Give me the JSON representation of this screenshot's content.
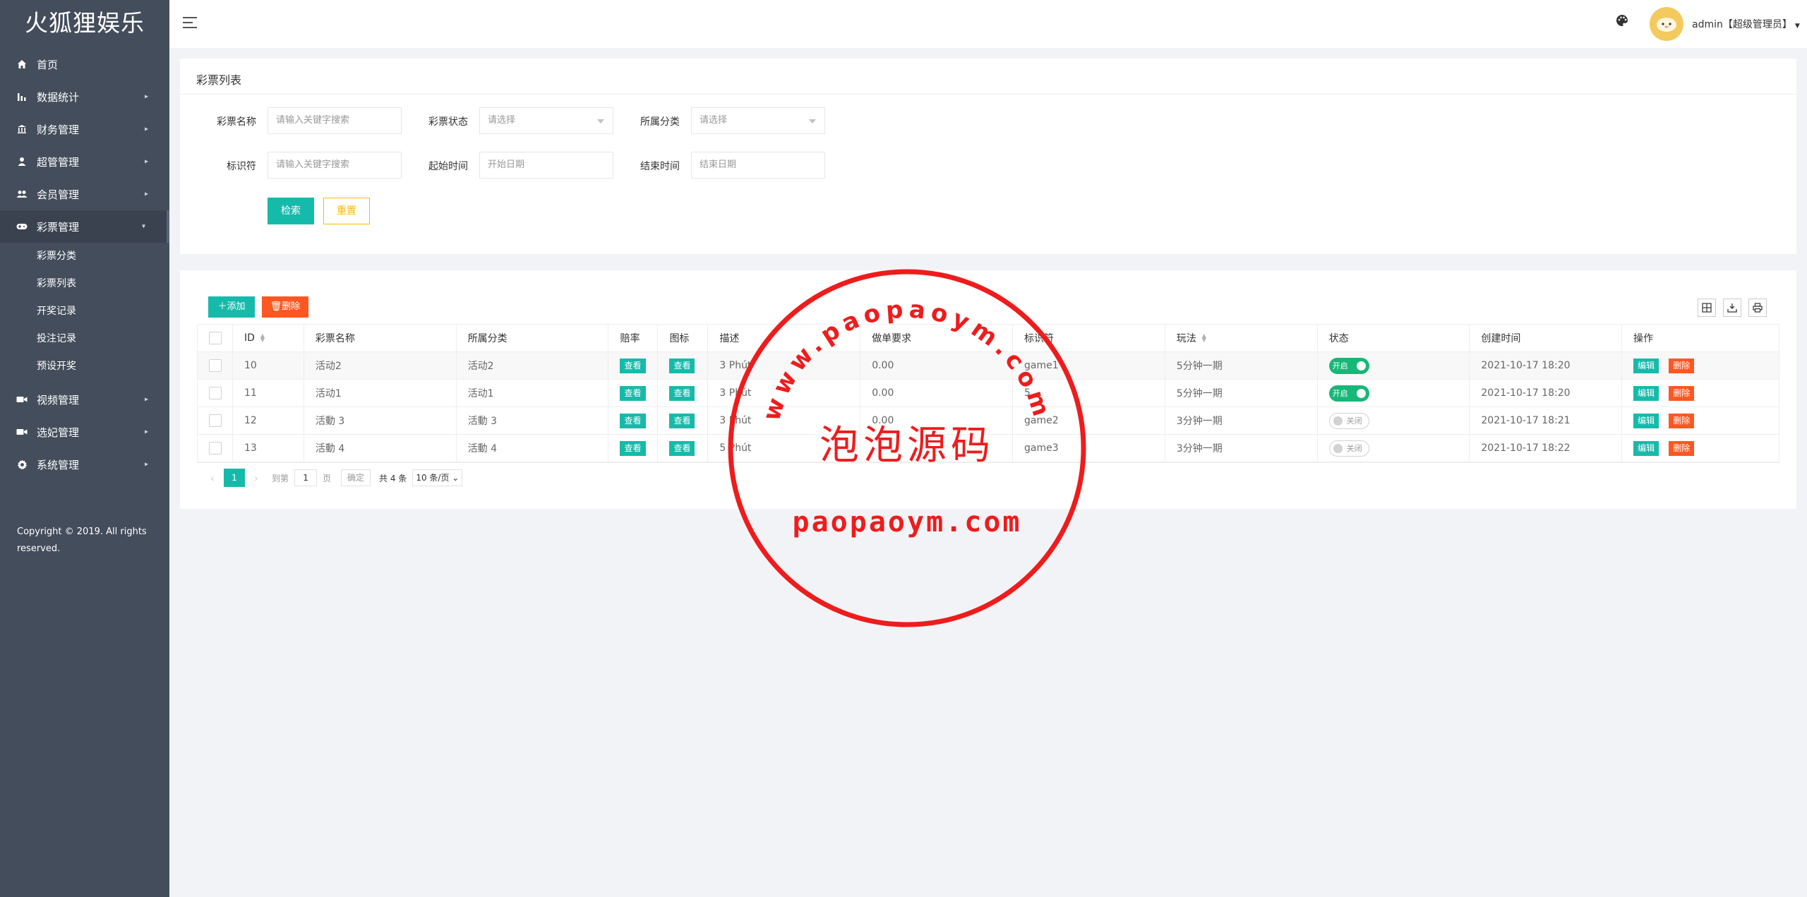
{
  "app": {
    "logo": "火狐狸娱乐"
  },
  "sidebar": {
    "items": [
      {
        "label": "首页",
        "icon": "home-icon"
      },
      {
        "label": "数据统计",
        "icon": "bar-chart-icon"
      },
      {
        "label": "财务管理",
        "icon": "bank-icon"
      },
      {
        "label": "超管管理",
        "icon": "user-icon"
      },
      {
        "label": "会员管理",
        "icon": "users-icon"
      },
      {
        "label": "彩票管理",
        "icon": "gamepad-icon"
      },
      {
        "label": "视频管理",
        "icon": "video-icon"
      },
      {
        "label": "选妃管理",
        "icon": "video-icon"
      },
      {
        "label": "系统管理",
        "icon": "gear-icon"
      }
    ],
    "sub_items": [
      {
        "label": "彩票分类"
      },
      {
        "label": "彩票列表"
      },
      {
        "label": "开奖记录"
      },
      {
        "label": "投注记录"
      },
      {
        "label": "预设开奖"
      }
    ],
    "copyright_line1": "Copyright © 2019. All rights",
    "copyright_line2": "reserved."
  },
  "header": {
    "user": "admin【超级管理员】",
    "icons": [
      "menu-icon",
      "palette-icon",
      "avatar"
    ]
  },
  "filter": {
    "title": "彩票列表",
    "name_label": "彩票名称",
    "name_placeholder": "请输入关键字搜索",
    "status_label": "彩票状态",
    "status_value": "请选择",
    "category_label": "所属分类",
    "category_value": "请选择",
    "key_label": "标识符",
    "key_placeholder": "请输入关键字搜索",
    "start_label": "起始时间",
    "start_placeholder": "开始日期",
    "end_label": "结束时间",
    "end_placeholder": "结束日期",
    "search_btn": "检索",
    "reset_btn": "重置"
  },
  "toolbar": {
    "add": "添加",
    "delete": "删除"
  },
  "table": {
    "columns": [
      "ID",
      "彩票名称",
      "所属分类",
      "赔率",
      "图标",
      "描述",
      "做单要求",
      "标识符",
      "玩法",
      "状态",
      "创建时间",
      "操作"
    ],
    "view_label": "查看",
    "edit_label": "编辑",
    "delete_label": "删除",
    "on_label": "开启",
    "off_label": "关闭",
    "rows": [
      {
        "id": "10",
        "name": "活动2",
        "category": "活动2",
        "desc": "3 Phút",
        "requirement": "0.00",
        "key": "game1",
        "play": "5分钟一期",
        "status": "on",
        "created": "2021-10-17 18:20"
      },
      {
        "id": "11",
        "name": "活动1",
        "category": "活动1",
        "desc": "3 Phút",
        "requirement": "0.00",
        "key": "5",
        "play": "5分钟一期",
        "status": "on",
        "created": "2021-10-17 18:20"
      },
      {
        "id": "12",
        "name": "活動 3",
        "category": "活動 3",
        "desc": "3 Phút",
        "requirement": "0.00",
        "key": "game2",
        "play": "3分钟一期",
        "status": "off",
        "created": "2021-10-17 18:21"
      },
      {
        "id": "13",
        "name": "活動 4",
        "category": "活動 4",
        "desc": "5 Phút",
        "requirement": "",
        "key": "game3",
        "play": "3分钟一期",
        "status": "off",
        "created": "2021-10-17 18:22"
      }
    ]
  },
  "pager": {
    "current": "1",
    "goto_label": "到第",
    "page_input": "1",
    "page_unit": "页",
    "confirm": "确定",
    "total": "共 4 条",
    "size": "10 条/页"
  },
  "watermark": {
    "top_text": "www.paopaoym.com",
    "center_text": "泡泡源码",
    "bottom_text": "paopaoym.com"
  },
  "colors": {
    "sidebar_bg": "#444d5b",
    "primary": "#16baaa",
    "danger": "#ff5722",
    "warning": "#ffb800",
    "switch_on": "#16b777",
    "stamp_red": "#ee1c1c"
  }
}
